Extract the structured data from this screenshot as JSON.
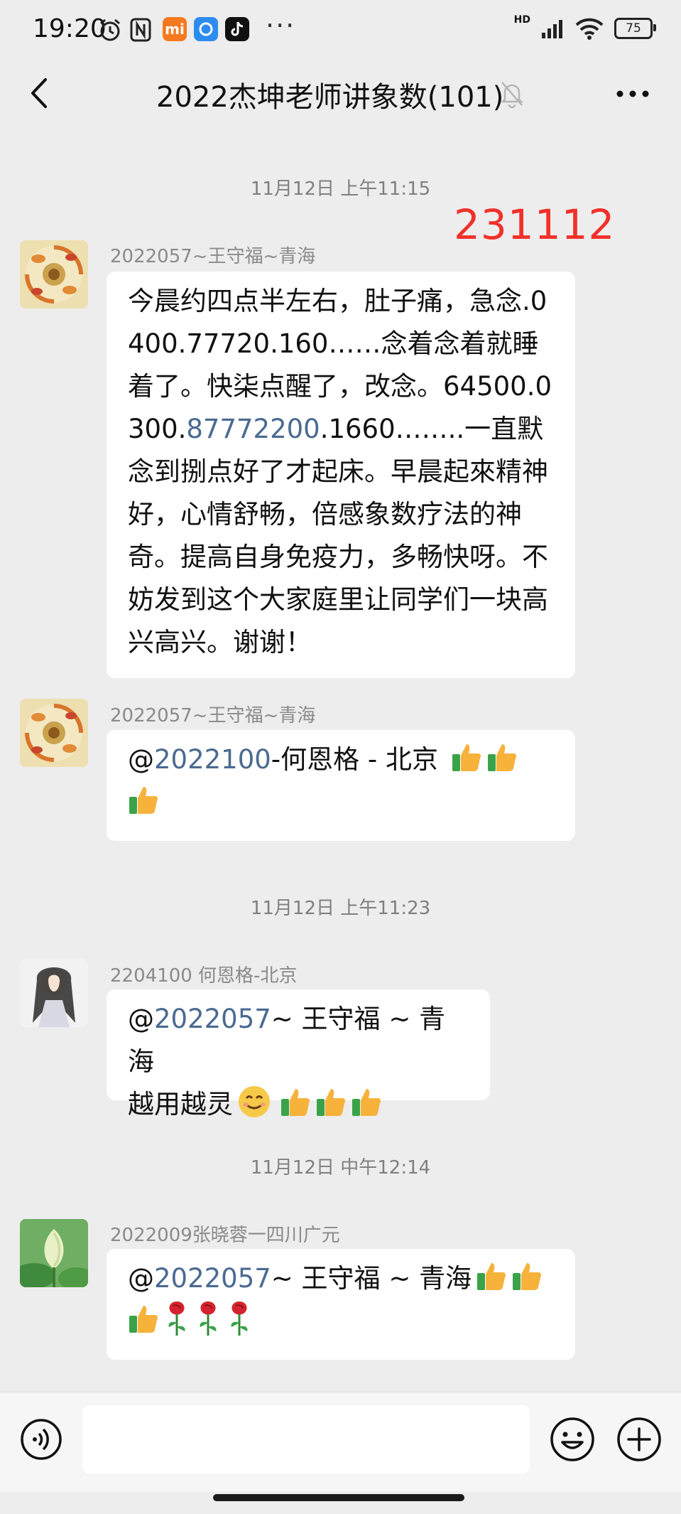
{
  "status_bar": {
    "time": "19:20",
    "dots": "···",
    "network": "HD",
    "battery": "75"
  },
  "header": {
    "title": "2022杰坤老师讲象数(101)"
  },
  "red_tag": "231112",
  "timestamps": [
    "11月12日 上午11:15",
    "11月12日 上午11:23",
    "11月12日 中午12:14"
  ],
  "messages": [
    {
      "sender": "2022057~王守福~青海",
      "text_parts": [
        "今晨约四点半左右，肚子痛，急念.0400.77720.160……念着念着就睡着了。快柒点醒了，改念。64500.0300.",
        "87772200",
        ".1660……..一直默念到捌点好了才起床。早晨起來精神好，心情舒畅，倍感象数疗法的神奇。提高自身免疫力，多畅快呀。不妨发到这个大家庭里让同学们一块高兴高兴。谢谢！"
      ]
    },
    {
      "sender": "2022057~王守福~青海",
      "at": "@",
      "mention": "2022100",
      "after": "-何恩格 - 北京"
    },
    {
      "sender": "2204100 何恩格-北京",
      "at": "@",
      "mention": "2022057",
      "after": "~ 王守福 ~ 青海",
      "line2": "越用越灵"
    },
    {
      "sender": "2022009张晓蓉一四川广元",
      "at": "@",
      "mention": "2022057",
      "after": "~ 王守福 ~ 青海"
    }
  ],
  "icons": {
    "back": "chevron-left-icon",
    "mute": "bell-off-icon",
    "more": "more-dots-icon",
    "voice": "voice-icon",
    "emoji": "emoji-icon",
    "plus": "plus-icon"
  },
  "colors": {
    "background": "#ededed",
    "bubble": "#ffffff",
    "link": "#4a6a91",
    "red_tag": "#f2302a"
  }
}
